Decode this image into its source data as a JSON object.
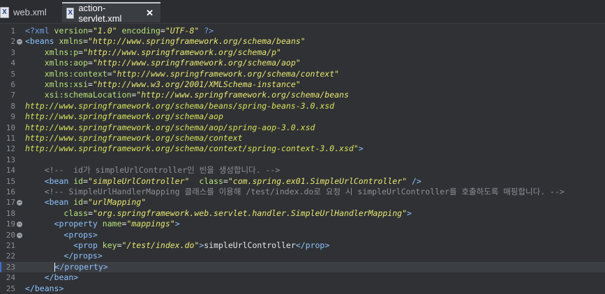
{
  "tabs": [
    {
      "label": "web.xml",
      "active": false,
      "icon": "xml-file-icon"
    },
    {
      "label": "action-servlet.xml",
      "active": true,
      "icon": "xml-file-icon"
    }
  ],
  "editor": {
    "current_line": 23,
    "lines": [
      {
        "n": "1",
        "fold": false,
        "segs": [
          [
            "pi",
            "<?xml "
          ],
          [
            "attr",
            "version"
          ],
          [
            "txt",
            "="
          ],
          [
            "val",
            "\"1.0\""
          ],
          [
            "txt",
            " "
          ],
          [
            "attr",
            "encoding"
          ],
          [
            "txt",
            "="
          ],
          [
            "val",
            "\"UTF-8\""
          ],
          [
            "pi",
            " ?>"
          ]
        ]
      },
      {
        "n": "2",
        "fold": true,
        "segs": [
          [
            "tag",
            "<beans "
          ],
          [
            "attr",
            "xmlns"
          ],
          [
            "txt",
            "="
          ],
          [
            "val",
            "\"http://www.springframework.org/schema/beans\""
          ]
        ]
      },
      {
        "n": "3",
        "fold": false,
        "segs": [
          [
            "txt",
            "    "
          ],
          [
            "attr",
            "xmlns:p"
          ],
          [
            "txt",
            "="
          ],
          [
            "val",
            "\"http://www.springframework.org/schema/p\""
          ]
        ]
      },
      {
        "n": "4",
        "fold": false,
        "segs": [
          [
            "txt",
            "    "
          ],
          [
            "attr",
            "xmlns:aop"
          ],
          [
            "txt",
            "="
          ],
          [
            "val",
            "\"http://www.springframework.org/schema/aop\""
          ]
        ]
      },
      {
        "n": "5",
        "fold": false,
        "segs": [
          [
            "txt",
            "    "
          ],
          [
            "attr",
            "xmlns:context"
          ],
          [
            "txt",
            "="
          ],
          [
            "val",
            "\"http://www.springframework.org/schema/context\""
          ]
        ]
      },
      {
        "n": "6",
        "fold": false,
        "segs": [
          [
            "txt",
            "    "
          ],
          [
            "attr",
            "xmlns:xsi"
          ],
          [
            "txt",
            "="
          ],
          [
            "val",
            "\"http://www.w3.org/2001/XMLSchema-instance\""
          ]
        ]
      },
      {
        "n": "7",
        "fold": false,
        "segs": [
          [
            "txt",
            "    "
          ],
          [
            "attr",
            "xsi:schemaLocation"
          ],
          [
            "txt",
            "="
          ],
          [
            "val",
            "\"http://www.springframework.org/schema/beans"
          ]
        ]
      },
      {
        "n": "8",
        "fold": false,
        "segs": [
          [
            "url",
            "http://www.springframework.org/schema/beans/spring-beans-3.0.xsd"
          ]
        ]
      },
      {
        "n": "9",
        "fold": false,
        "segs": [
          [
            "url",
            "http://www.springframework.org/schema/aop"
          ]
        ]
      },
      {
        "n": "10",
        "fold": false,
        "segs": [
          [
            "url",
            "http://www.springframework.org/schema/aop/spring-aop-3.0.xsd"
          ]
        ]
      },
      {
        "n": "11",
        "fold": false,
        "segs": [
          [
            "url",
            "http://www.springframework.org/schema/context"
          ]
        ]
      },
      {
        "n": "12",
        "fold": false,
        "segs": [
          [
            "url",
            "http://www.springframework.org/schema/context/spring-context-3.0.xsd\""
          ],
          [
            "tag",
            ">"
          ]
        ]
      },
      {
        "n": "13",
        "fold": false,
        "segs": []
      },
      {
        "n": "14",
        "fold": false,
        "segs": [
          [
            "txt",
            "    "
          ],
          [
            "com",
            "<!--  id가 simpleUrlController인 빈을 생성합니다. -->"
          ]
        ]
      },
      {
        "n": "15",
        "fold": false,
        "segs": [
          [
            "txt",
            "    "
          ],
          [
            "tag",
            "<bean "
          ],
          [
            "attr",
            "id"
          ],
          [
            "txt",
            "="
          ],
          [
            "val",
            "\"simpleUrlController\""
          ],
          [
            "txt",
            "  "
          ],
          [
            "attr",
            "class"
          ],
          [
            "txt",
            "="
          ],
          [
            "val",
            "\"com.spring.ex01.SimpleUrlController\""
          ],
          [
            "tag",
            " />"
          ]
        ]
      },
      {
        "n": "16",
        "fold": false,
        "segs": [
          [
            "txt",
            "    "
          ],
          [
            "com",
            "<!-- SimpleUrlHandlerMapping 클래스를 이용해 /test/index.do로 요청 시 simpleUrlController를 호출하도록 매핑합니다. -->"
          ]
        ]
      },
      {
        "n": "17",
        "fold": true,
        "segs": [
          [
            "txt",
            "    "
          ],
          [
            "tag",
            "<bean "
          ],
          [
            "attr",
            "id"
          ],
          [
            "txt",
            "="
          ],
          [
            "val",
            "\"urlMapping\""
          ]
        ]
      },
      {
        "n": "18",
        "fold": false,
        "segs": [
          [
            "txt",
            "        "
          ],
          [
            "attr",
            "class"
          ],
          [
            "txt",
            "="
          ],
          [
            "val",
            "\"org.springframework.web.servlet.handler.SimpleUrlHandlerMapping\""
          ],
          [
            "tag",
            ">"
          ]
        ]
      },
      {
        "n": "19",
        "fold": true,
        "segs": [
          [
            "txt",
            "      "
          ],
          [
            "tag",
            "<property "
          ],
          [
            "attr",
            "name"
          ],
          [
            "txt",
            "="
          ],
          [
            "val",
            "\"mappings\""
          ],
          [
            "tag",
            ">"
          ]
        ]
      },
      {
        "n": "20",
        "fold": true,
        "segs": [
          [
            "txt",
            "        "
          ],
          [
            "tag",
            "<props>"
          ]
        ]
      },
      {
        "n": "21",
        "fold": false,
        "segs": [
          [
            "txt",
            "          "
          ],
          [
            "tag",
            "<prop "
          ],
          [
            "attr",
            "key"
          ],
          [
            "txt",
            "="
          ],
          [
            "val",
            "\"/test/index.do\""
          ],
          [
            "tag",
            ">"
          ],
          [
            "txt",
            "simpleUrlController"
          ],
          [
            "tag",
            "</prop>"
          ]
        ]
      },
      {
        "n": "22",
        "fold": false,
        "segs": [
          [
            "txt",
            "        "
          ],
          [
            "tag",
            "</props>"
          ]
        ]
      },
      {
        "n": "23",
        "fold": false,
        "segs": [
          [
            "txt",
            "      "
          ],
          [
            "tag",
            "</property>"
          ]
        ]
      },
      {
        "n": "24",
        "fold": false,
        "segs": [
          [
            "txt",
            "    "
          ],
          [
            "tag",
            "</bean>"
          ]
        ]
      },
      {
        "n": "25",
        "fold": false,
        "segs": [
          [
            "tag",
            "</beans>"
          ]
        ]
      }
    ]
  }
}
